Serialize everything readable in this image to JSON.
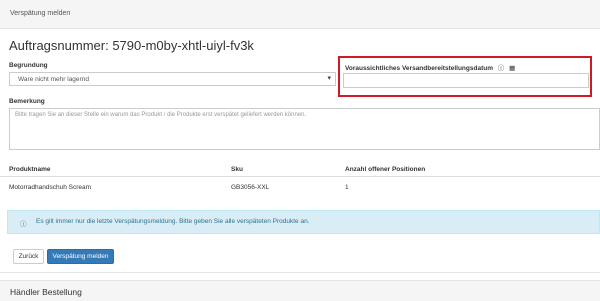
{
  "panel": {
    "header_title": "Verspätung melden"
  },
  "order": {
    "title": "Auftragsnummer: 5790-m0by-xhtl-uiyl-fv3k"
  },
  "form": {
    "reason_label": "Begrundung",
    "reason_value": "Ware nicht mehr lagernd",
    "date_label": "Voraussichtliches Versandbereitstellungsdatum",
    "date_value": "",
    "remark_label": "Bemerkung",
    "remark_placeholder": "Bitte tragen Sie an dieser Stelle ein warum das Produkt / die Produkte erst verspätet geliefert werden können."
  },
  "table": {
    "headers": [
      "Produktname",
      "Sku",
      "Anzahl offener Positionen"
    ],
    "rows": [
      [
        "Motorradhandschuh Scream",
        "GB3056-XXL",
        "1"
      ]
    ]
  },
  "info": {
    "message": "Es gilt immer nur die letzte Verspätungsmeldung. Bitte geben Sie alle verspäteten Produkte an."
  },
  "buttons": {
    "back": "Zurück",
    "report": "Verspätung melden"
  },
  "section2": {
    "title": "Händler Bestellung"
  },
  "icons": {
    "info": "info-circle-icon",
    "calendar": "calendar-icon",
    "caret": "caret-down-icon"
  },
  "colors": {
    "primary": "#337ab7",
    "highlight": "#cc1a28",
    "info_bg": "#d9edf7",
    "info_text": "#31708f"
  }
}
